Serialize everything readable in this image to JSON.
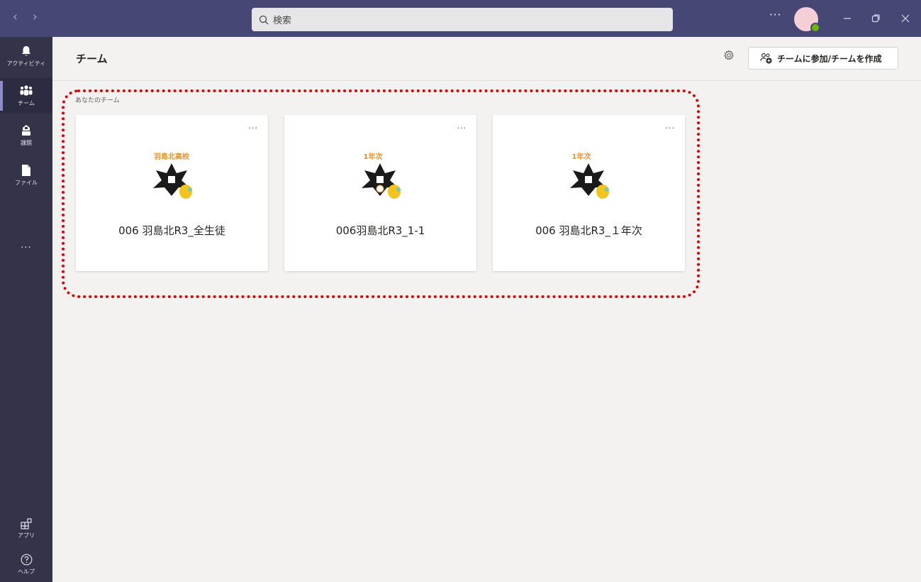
{
  "titlebar": {
    "back_arrow": "‹",
    "forward_arrow": "›",
    "search_placeholder": "検索",
    "more": "···",
    "presence_color": "#6bb700"
  },
  "rail": {
    "items": [
      {
        "label": "アクティビティ",
        "icon": "bell-icon"
      },
      {
        "label": "チーム",
        "icon": "teams-icon"
      },
      {
        "label": "課題",
        "icon": "assignments-icon"
      },
      {
        "label": "ファイル",
        "icon": "file-icon"
      }
    ],
    "more": "···",
    "apps_label": "アプリ",
    "help_label": "ヘルプ"
  },
  "header": {
    "title": "チーム",
    "join_button": "チームに参加/チームを作成"
  },
  "section": {
    "label": "あなたのチーム"
  },
  "teams": [
    {
      "name": "006 羽島北R3_全生徒",
      "logo_text": "羽島北高校",
      "more": "···"
    },
    {
      "name": "006羽島北R3_1-1",
      "logo_text": "1年次",
      "more": "···"
    },
    {
      "name": "006 羽島北R3_１年次",
      "logo_text": "1年次",
      "more": "···"
    }
  ],
  "colors": {
    "titlebar": "#464775",
    "rail": "#33344a",
    "highlight": "#e00000"
  }
}
